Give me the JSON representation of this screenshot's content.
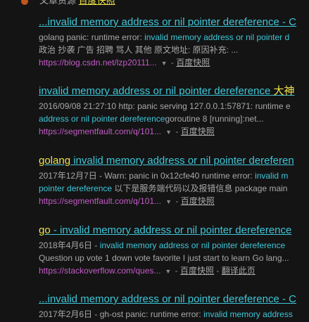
{
  "top": {
    "text": "文章资源 ",
    "link": "百度快照"
  },
  "results": [
    {
      "title_parts": [
        {
          "t": "...invalid memory address or nil pointer dereference - C",
          "c": ""
        }
      ],
      "desc1_parts": [
        {
          "t": "golang panic: runtime error: ",
          "c": ""
        },
        {
          "t": "invalid memory address or nil pointer d",
          "c": "hl"
        }
      ],
      "desc2_parts": [
        {
          "t": "政治 抄袭 广告 招聘 骂人 其他 原文地址: 原因补充: ...",
          "c": ""
        }
      ],
      "url": "https://blog.csdn.net/lzp20111...",
      "links": [
        "百度快照"
      ]
    },
    {
      "title_parts": [
        {
          "t": "invalid memory address or nil pointer dereference ",
          "c": ""
        },
        {
          "t": "大神",
          "c": "yellow"
        }
      ],
      "desc1_parts": [
        {
          "t": "2016/09/08 21:27:10 http: panic serving 127.0.0.1:57871: runtime e",
          "c": ""
        }
      ],
      "desc2_parts": [
        {
          "t": "address or nil pointer dereference",
          "c": "hl"
        },
        {
          "t": "goroutine 8 [running]:net...",
          "c": ""
        }
      ],
      "url": "https://segmentfault.com/q/101...",
      "links": [
        "百度快照"
      ]
    },
    {
      "title_parts": [
        {
          "t": "golang",
          "c": "yellow"
        },
        {
          "t": " invalid memory address or nil pointer dereferen",
          "c": ""
        }
      ],
      "desc1_parts": [
        {
          "t": "2017年12月7日 -  Warn: panic in 0x12cfe40 runtime error: ",
          "c": ""
        },
        {
          "t": "invalid m",
          "c": "hl"
        }
      ],
      "desc2_parts": [
        {
          "t": "pointer dereference",
          "c": "hl"
        },
        {
          "t": " 以下是服务端代码以及报错信息 package main",
          "c": ""
        }
      ],
      "url": "https://segmentfault.com/q/101...",
      "links": [
        "百度快照"
      ]
    },
    {
      "title_parts": [
        {
          "t": "go",
          "c": "yellow"
        },
        {
          "t": " - invalid memory address or nil pointer dereference",
          "c": ""
        }
      ],
      "desc1_parts": [
        {
          "t": "2018年4月6日 - ",
          "c": ""
        },
        {
          "t": "invalid memory address or nil pointer dereference",
          "c": "hl"
        }
      ],
      "desc2_parts": [
        {
          "t": "Question up vote 1 down vote favorite I just start to learn Go lang...",
          "c": ""
        }
      ],
      "url": "https://stackoverflow.com/ques...",
      "links": [
        "百度快照",
        "翻译此页"
      ]
    },
    {
      "title_parts": [
        {
          "t": "...invalid memory address or nil pointer dereference - C",
          "c": ""
        }
      ],
      "desc1_parts": [
        {
          "t": "2017年2月6日 -  gh-ost panic: runtime error: ",
          "c": ""
        },
        {
          "t": "invalid memory address",
          "c": "hl"
        }
      ],
      "desc2_parts": [],
      "url": "",
      "links": []
    }
  ]
}
